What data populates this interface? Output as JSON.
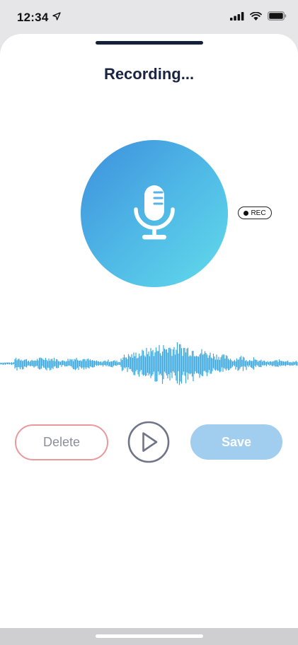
{
  "status_bar": {
    "time": "12:34",
    "icons": [
      "location-arrow-icon",
      "signal-bars-icon",
      "wifi-icon",
      "battery-icon"
    ]
  },
  "screen": {
    "title": "Recording..."
  },
  "recorder": {
    "mic_icon": "microphone-icon",
    "rec_label": "REC",
    "gradient_start": "#3d8fdc",
    "gradient_end": "#62dbeb",
    "waveform_color": "#3aa8de"
  },
  "actions": {
    "delete_label": "Delete",
    "play_icon": "play-icon",
    "save_label": "Save",
    "delete_border_color": "#e9999b",
    "save_bg_color": "#a1cdee"
  }
}
